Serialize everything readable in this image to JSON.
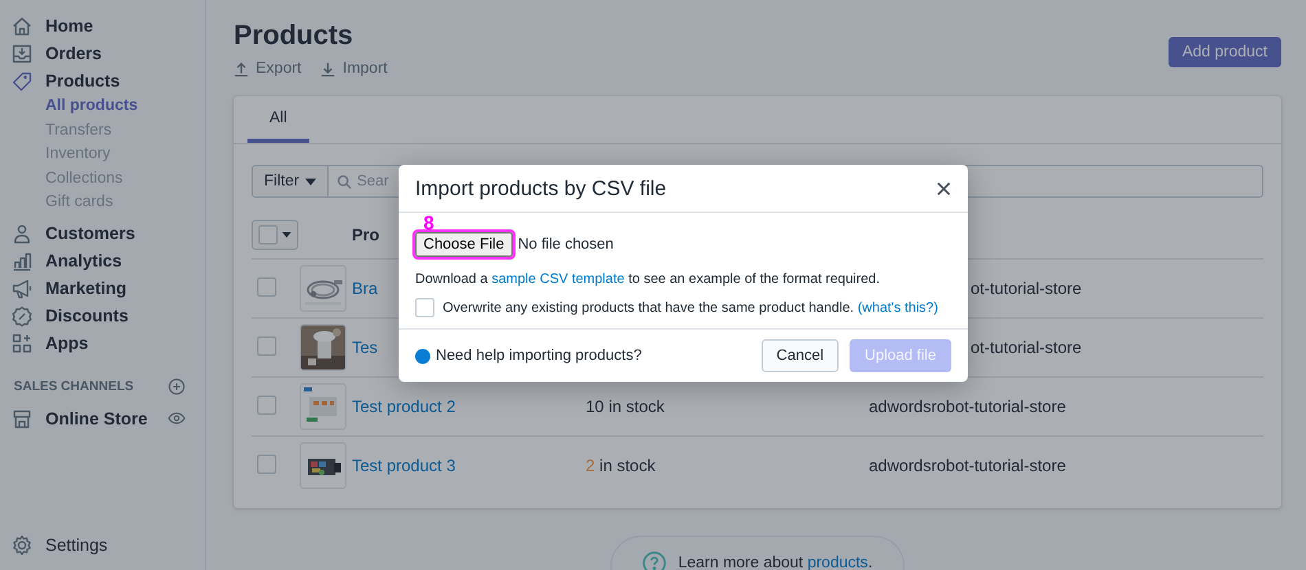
{
  "sidebar": {
    "items": [
      {
        "label": "Home",
        "selected": false
      },
      {
        "label": "Orders",
        "selected": false
      },
      {
        "label": "Products",
        "selected": false,
        "children": [
          {
            "label": "All products",
            "selected": true
          },
          {
            "label": "Transfers",
            "selected": false
          },
          {
            "label": "Inventory",
            "selected": false
          },
          {
            "label": "Collections",
            "selected": false
          },
          {
            "label": "Gift cards",
            "selected": false
          }
        ]
      },
      {
        "label": "Customers",
        "selected": false
      },
      {
        "label": "Analytics",
        "selected": false
      },
      {
        "label": "Marketing",
        "selected": false
      },
      {
        "label": "Discounts",
        "selected": false
      },
      {
        "label": "Apps",
        "selected": false
      }
    ],
    "sales_channels": {
      "heading": "SALES CHANNELS",
      "items": [
        {
          "label": "Online Store"
        }
      ]
    },
    "settings": "Settings"
  },
  "page": {
    "title": "Products",
    "actions": [
      "Export",
      "Import"
    ],
    "primary_button": "Add product"
  },
  "card": {
    "tabs": [
      {
        "label": "All",
        "selected": true
      }
    ],
    "filter_button": "Filter",
    "search_placeholder": "Sear",
    "select_all": {
      "checked": false
    },
    "header": {
      "product": "Pro"
    },
    "rows": [
      {
        "checked": false,
        "name": "Bra",
        "covered": true,
        "store": "ot-tutorial-store"
      },
      {
        "checked": false,
        "name": "Tes",
        "covered": true,
        "store": "ot-tutorial-store"
      },
      {
        "checked": false,
        "name": "Test product 2",
        "covered": false,
        "inventory": {
          "count": "10",
          "text": "in stock",
          "low": false
        },
        "store": "adwordsrobot-tutorial-store"
      },
      {
        "checked": false,
        "name": "Test product 3",
        "covered": false,
        "inventory": {
          "count": "2",
          "text": "in stock",
          "low": true
        },
        "store": "adwordsrobot-tutorial-store"
      }
    ]
  },
  "learn_more": {
    "text": "Learn more about",
    "link": "products",
    "end": "."
  },
  "modal": {
    "title": "Import products by CSV file",
    "annotation": "8",
    "file_button": "Choose File",
    "file_status": "No file chosen",
    "description": {
      "before": "Download a",
      "link": "sample CSV template",
      "after": "to see an example of the format required."
    },
    "overwrite": {
      "label": "Overwrite any existing products that have the same product handle.",
      "link": "(what's this?)",
      "checked": false
    },
    "help": "Need help importing products?",
    "buttons": [
      {
        "label": "Cancel",
        "kind": "secondary",
        "disabled": false
      },
      {
        "label": "Upload file",
        "kind": "primary",
        "disabled": true
      }
    ]
  }
}
